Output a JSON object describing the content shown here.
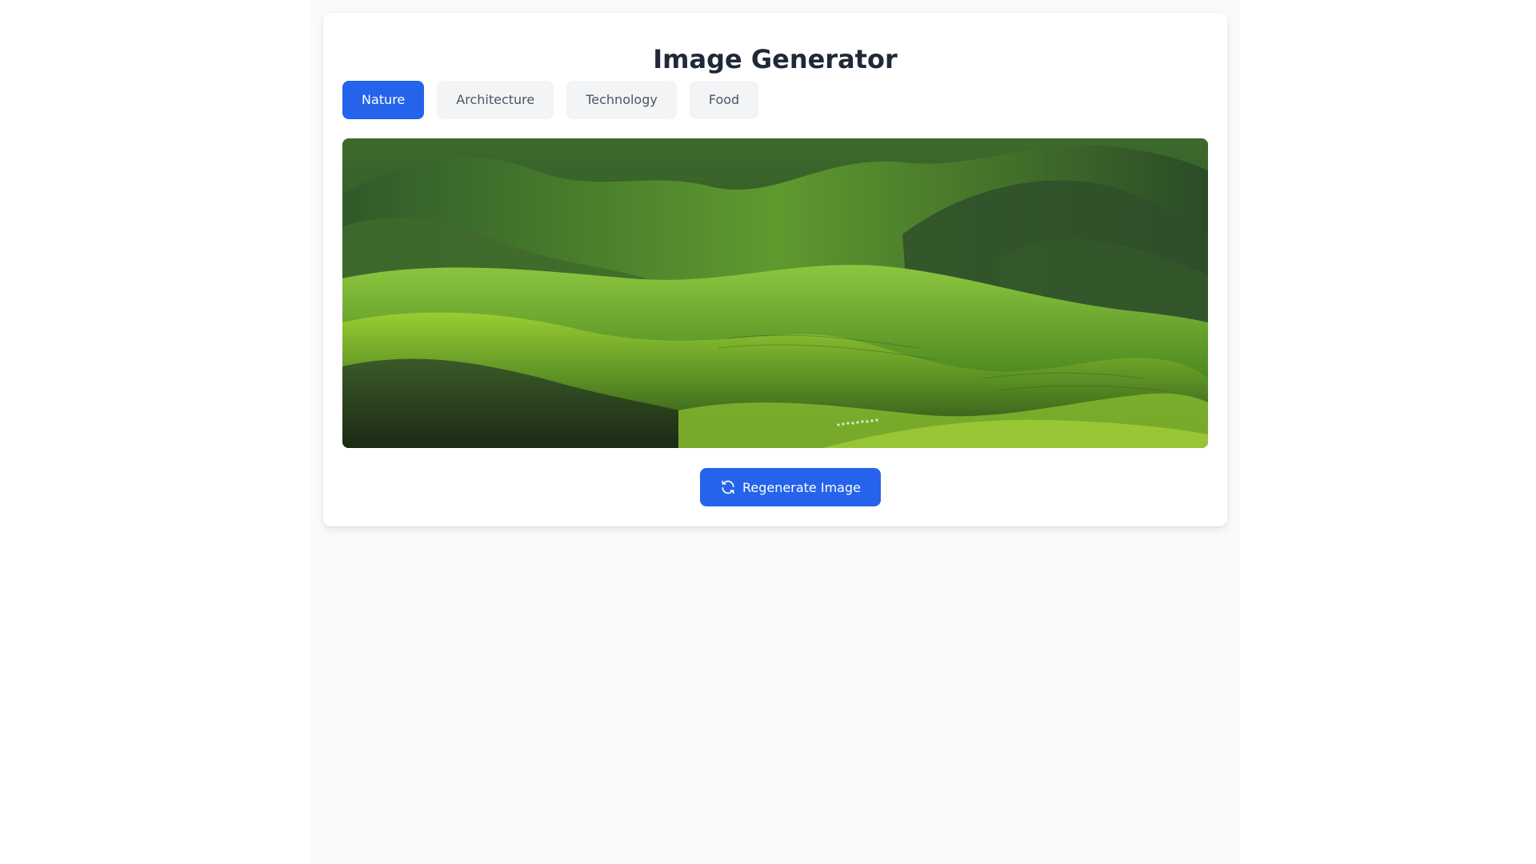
{
  "title": "Image Generator",
  "categories": [
    {
      "label": "Nature",
      "active": true
    },
    {
      "label": "Architecture",
      "active": false
    },
    {
      "label": "Technology",
      "active": false
    },
    {
      "label": "Food",
      "active": false
    }
  ],
  "image": {
    "category": "Nature",
    "subject": "rolling green hills"
  },
  "regenerate": {
    "label": "Regenerate Image",
    "icon": "refresh-icon"
  },
  "colors": {
    "accent": "#2563eb",
    "tab_inactive_bg": "#f3f4f6",
    "tab_inactive_text": "#4b5563",
    "title_text": "#1f2937",
    "page_bg": "#f9fafb",
    "card_bg": "#ffffff"
  }
}
